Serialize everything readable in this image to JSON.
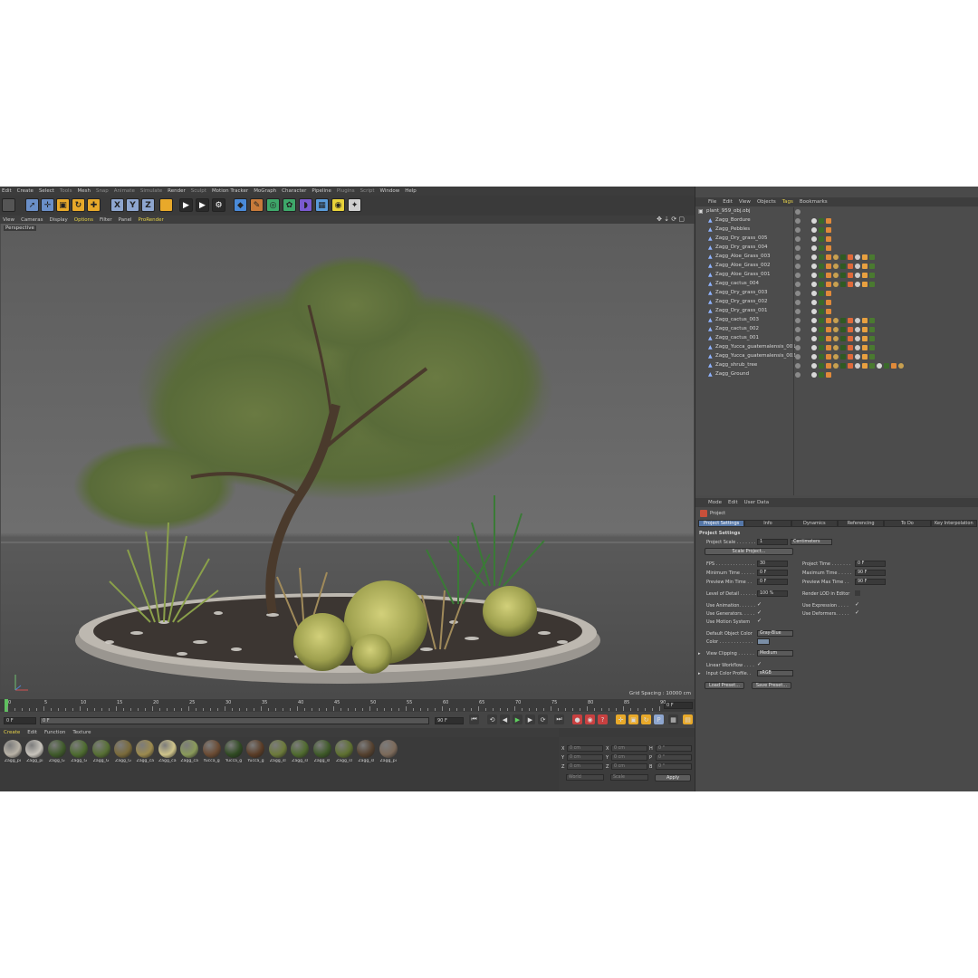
{
  "menu": [
    "Edit",
    "Create",
    "Select",
    "Tools",
    "Mesh",
    "Snap",
    "Animate",
    "Simulate",
    "Render",
    "Sculpt",
    "Motion Tracker",
    "MoGraph",
    "Character",
    "Pipeline",
    "Plugins",
    "Script",
    "Window",
    "Help"
  ],
  "toolbar": {
    "x_label": "X",
    "y_label": "Y",
    "z_label": "Z"
  },
  "viewport_menu": [
    "View",
    "Cameras",
    "Display",
    "Options",
    "Filter",
    "Panel",
    "ProRender"
  ],
  "viewport": {
    "label": "Perspective",
    "grid_spacing": "Grid Spacing : 10000 cm"
  },
  "timeline": {
    "ticks": [
      "0",
      "5",
      "10",
      "15",
      "20",
      "25",
      "30",
      "35",
      "40",
      "45",
      "50",
      "55",
      "60",
      "65",
      "70",
      "75",
      "80",
      "85",
      "90"
    ],
    "end_field": "0 F",
    "start_field": "0 F",
    "range_start": "0 F",
    "range_end": "90 F",
    "max_field": "90 F"
  },
  "material_menu": [
    "Create",
    "Edit",
    "Function",
    "Texture"
  ],
  "materials": [
    {
      "label": "Zagg_pi",
      "color": "#b8b2a6"
    },
    {
      "label": "Zagg_pi",
      "color": "#c8c4bc"
    },
    {
      "label": "Zagg_G",
      "color": "#3f5a2a"
    },
    {
      "label": "Zagg_G",
      "color": "#4d6b2f"
    },
    {
      "label": "Zagg_G",
      "color": "#566f33"
    },
    {
      "label": "Zagg_G",
      "color": "#7a6a3a"
    },
    {
      "label": "Zagg_ca",
      "color": "#9c8a4e"
    },
    {
      "label": "Zagg_ca",
      "color": "#cfc48a"
    },
    {
      "label": "Zagg_ca",
      "color": "#8a9a5a"
    },
    {
      "label": "Yucca_g",
      "color": "#6a4a32"
    },
    {
      "label": "Yucca_g",
      "color": "#2f4a22"
    },
    {
      "label": "Yucca_g",
      "color": "#5a3c26"
    },
    {
      "label": "Zagg_sl",
      "color": "#6c7a3a"
    },
    {
      "label": "Zagg_sl",
      "color": "#4f6a2e"
    },
    {
      "label": "Zagg_sl",
      "color": "#3e5a28"
    },
    {
      "label": "Zagg_sl",
      "color": "#5e7030"
    },
    {
      "label": "Zagg_sl",
      "color": "#54402e"
    },
    {
      "label": "Zagg_pi",
      "color": "#7c6a5a"
    }
  ],
  "coords": {
    "rows": [
      {
        "axis": "X",
        "pos": "0 cm",
        "axis2": "X",
        "size": "0 cm",
        "axis3": "H",
        "rot": "0 °"
      },
      {
        "axis": "Y",
        "pos": "0 cm",
        "axis2": "Y",
        "size": "0 cm",
        "axis3": "P",
        "rot": "0 °"
      },
      {
        "axis": "Z",
        "pos": "0 cm",
        "axis2": "Z",
        "size": "0 cm",
        "axis3": "B",
        "rot": "0 °"
      }
    ],
    "mode": "World",
    "size_mode": "Scale",
    "apply": "Apply"
  },
  "object_manager": {
    "menu": [
      "File",
      "Edit",
      "View",
      "Objects",
      "Tags",
      "Bookmarks"
    ],
    "objects": [
      {
        "name": "plant_959_obj.obj",
        "root": true,
        "tags": 0
      },
      {
        "name": "Zagg_Bordure",
        "tags": 3
      },
      {
        "name": "Zagg_Pebbles",
        "tags": 3
      },
      {
        "name": "Zagg_Dry_grass_005",
        "tags": 3
      },
      {
        "name": "Zagg_Dry_grass_004",
        "tags": 3
      },
      {
        "name": "Zagg_Aloe_Grass_003",
        "tags": 9
      },
      {
        "name": "Zagg_Aloe_Grass_002",
        "tags": 9
      },
      {
        "name": "Zagg_Aloe_Grass_001",
        "tags": 9
      },
      {
        "name": "Zagg_cactus_004",
        "tags": 9
      },
      {
        "name": "Zagg_Dry_grass_003",
        "tags": 3
      },
      {
        "name": "Zagg_Dry_grass_002",
        "tags": 3
      },
      {
        "name": "Zagg_Dry_grass_001",
        "tags": 3
      },
      {
        "name": "Zagg_cactus_003",
        "tags": 9
      },
      {
        "name": "Zagg_cactus_002",
        "tags": 9
      },
      {
        "name": "Zagg_cactus_001",
        "tags": 9
      },
      {
        "name": "Zagg_Yucca_guatemalensis_001",
        "tags": 9
      },
      {
        "name": "Zagg_Yucca_guatemalensis_002",
        "tags": 9
      },
      {
        "name": "Zagg_shrub_tree",
        "tags": 13
      },
      {
        "name": "Zagg_Ground",
        "tags": 3
      }
    ]
  },
  "attributes": {
    "menu": [
      "Mode",
      "Edit",
      "User Data"
    ],
    "title": "Project",
    "tabs": [
      "Project Settings",
      "Info",
      "Dynamics",
      "Referencing",
      "To Do",
      "Key Interpolation"
    ],
    "section": "Project Settings",
    "project_scale_label": "Project Scale . . . . . . .",
    "project_scale_value": "1",
    "project_scale_unit": "Centimeters",
    "scale_button": "Scale Project...",
    "fps_label": "FPS . . . . . . . . . . . . . .",
    "fps": "30",
    "project_time_label": "Project Time . . . . . . .",
    "project_time": "0 F",
    "min_time_label": "Minimum Time . . . . .",
    "min_time": "0 F",
    "max_time_label": "Maximum Time . . . . .",
    "max_time": "90 F",
    "prev_min_label": "Preview Min Time . .",
    "prev_min": "0 F",
    "prev_max_label": "Preview Max Time . .",
    "prev_max": "90 F",
    "lod_label": "Level of Detail . . . . . .",
    "lod": "100 %",
    "render_lod_label": "Render LOD in Editor",
    "use_anim_label": "Use Animation. . . . . .",
    "use_expr_label": "Use Expression . . . .",
    "use_gen_label": "Use Generators. . . . .",
    "use_def_label": "Use Deformers. . . . .",
    "use_motion_label": "Use Motion System",
    "default_color_label": "Default Object Color",
    "default_color": "Gray-Blue",
    "color_label": "Color . . . . . . . . . . . .",
    "view_clip_label": "View Clipping . . . . . .",
    "view_clip": "Medium",
    "linear_label": "Linear Workflow . . . .",
    "input_profile_label": "Input Color Profile. .",
    "input_profile": "sRGB",
    "load_preset": "Load Preset...",
    "save_preset": "Save Preset..."
  }
}
